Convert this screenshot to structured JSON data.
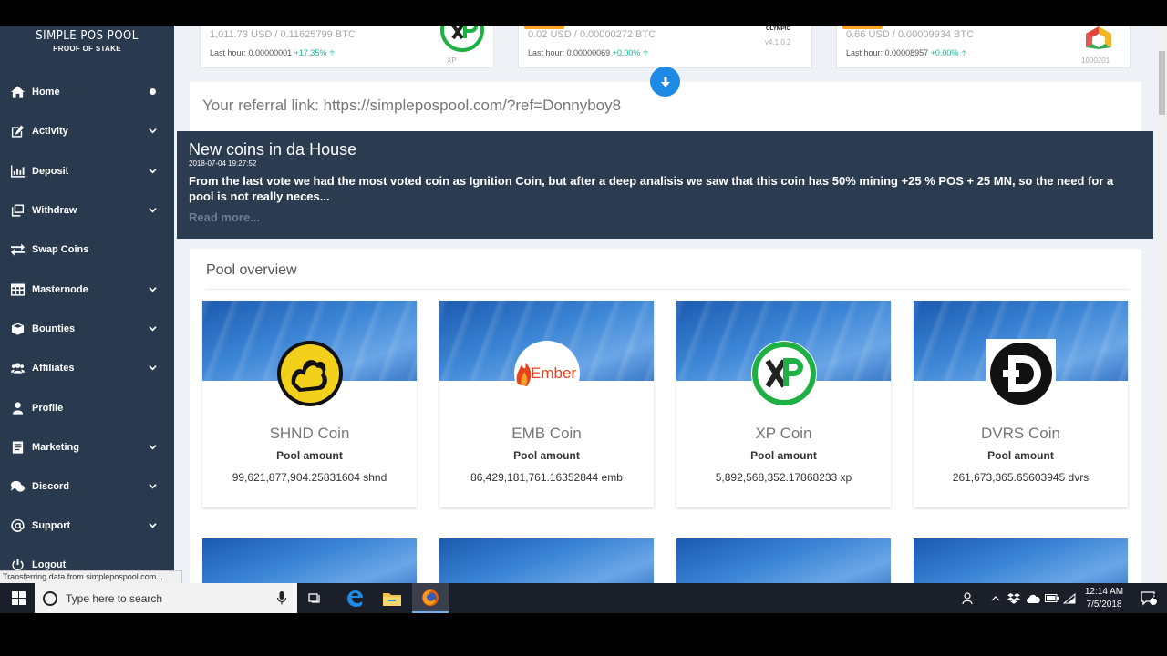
{
  "brand": {
    "line1": "SIMPLE POS POOL",
    "line2": "PROOF OF STAKE"
  },
  "sidebar": {
    "items": [
      {
        "label": "Home",
        "icon": "home-icon"
      },
      {
        "label": "Activity",
        "icon": "edit-icon"
      },
      {
        "label": "Deposit",
        "icon": "bar-chart-icon"
      },
      {
        "label": "Withdraw",
        "icon": "copy-icon"
      },
      {
        "label": "Swap Coins",
        "icon": "swap-icon"
      },
      {
        "label": "Masternode",
        "icon": "table-icon"
      },
      {
        "label": "Bounties",
        "icon": "cube-icon"
      },
      {
        "label": "Affiliates",
        "icon": "users-icon"
      },
      {
        "label": "Profile",
        "icon": "user-icon"
      },
      {
        "label": "Marketing",
        "icon": "document-icon"
      },
      {
        "label": "Discord",
        "icon": "chat-icon"
      },
      {
        "label": "Support",
        "icon": "at-icon"
      },
      {
        "label": "Logout",
        "icon": "power-icon"
      }
    ]
  },
  "status_text": "Transferring data from simplepospool.com...",
  "tickers": [
    {
      "price": "1,011.73 USD / 0.11625799 BTC",
      "last_hour_label": "Last hour:",
      "last_hour_value": "0.00000001",
      "change": "+17.35%",
      "version": "XP"
    },
    {
      "price": "0.02 USD / 0.00000272 BTC",
      "last_hour_label": "Last hour:",
      "last_hour_value": "0.00000069",
      "change": "+0.00%",
      "version": "v4.1.0.2",
      "brand": "OLYMPIC"
    },
    {
      "price": "0.66 USD / 0.00009934 BTC",
      "last_hour_label": "Last hour:",
      "last_hour_value": "0.00008957",
      "change": "+0.00%",
      "version": "1000201"
    }
  ],
  "referral": {
    "label": "Your referral link:",
    "url": "https://simplepospool.com/?ref=Donnyboy8"
  },
  "news": {
    "title": "New coins in da House",
    "date": "2018-07-04 19:27:52",
    "body": "From the last vote we had the most voted coin as Ignition Coin, but after a deep analisis we saw that this coin has 50% mining +25 % POS + 25 MN, so the need for a pool is not really neces...",
    "read_more": "Read more..."
  },
  "pool": {
    "heading": "Pool overview",
    "cards": [
      {
        "name": "SHND Coin",
        "label": "Pool amount",
        "amount": "99,621,877,904.25831604 shnd",
        "logo": "shnd-logo"
      },
      {
        "name": "EMB Coin",
        "label": "Pool amount",
        "amount": "86,429,181,761.16352844 emb",
        "logo": "ember-logo",
        "logo_text": "Ember"
      },
      {
        "name": "XP Coin",
        "label": "Pool amount",
        "amount": "5,892,568,352.17868233 xp",
        "logo": "xp-logo"
      },
      {
        "name": "DVRS Coin",
        "label": "Pool amount",
        "amount": "261,673,365.65603945 dvrs",
        "logo": "dvrs-logo"
      }
    ]
  },
  "taskbar": {
    "search_placeholder": "Type here to search",
    "time": "12:14 AM",
    "date": "7/5/2018",
    "notification_count": "2"
  },
  "colors": {
    "sidebar": "#2a3a4e",
    "news": "#2b3b50",
    "accent": "#1e8ae5",
    "positive": "#16b89a"
  }
}
